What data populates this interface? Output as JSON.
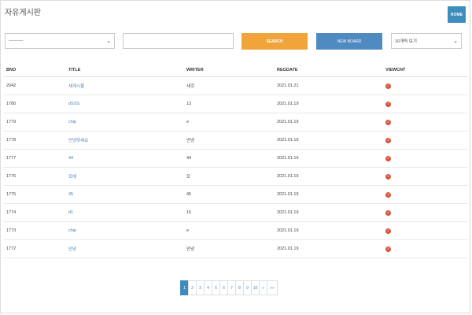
{
  "page": {
    "title": "자유게시판",
    "home_label": "HOME"
  },
  "search": {
    "type_select": "----------",
    "keyword_value": "",
    "search_label": "SEARCH",
    "new_board_label": "NEW BOARD",
    "page_size_select": "10개씩 보기"
  },
  "table": {
    "headers": [
      "BNO",
      "TITLE",
      "WRITER",
      "REGDATE",
      "VIEWCNT"
    ],
    "rows": [
      {
        "bno": "2042",
        "title": "새게시물",
        "writer": "새것",
        "regdate": "2021.01.21",
        "viewcnt": "2"
      },
      {
        "bno": "1780",
        "title": "dSSS",
        "writer": "13",
        "regdate": "2021.01.19",
        "viewcnt": "7"
      },
      {
        "bno": "1779",
        "title": "chip",
        "writer": "e",
        "regdate": "2021.01.19",
        "viewcnt": "2"
      },
      {
        "bno": "1778",
        "title": "안녕하세요",
        "writer": "안녕",
        "regdate": "2021.01.19",
        "viewcnt": "3"
      },
      {
        "bno": "1777",
        "title": "44",
        "writer": "44",
        "regdate": "2021.01.19",
        "viewcnt": "2"
      },
      {
        "bno": "1776",
        "title": "모에",
        "writer": "모",
        "regdate": "2021.01.19",
        "viewcnt": "3"
      },
      {
        "bno": "1775",
        "title": "45",
        "writer": "45",
        "regdate": "2021.01.19",
        "viewcnt": "3"
      },
      {
        "bno": "1774",
        "title": "d1",
        "writer": "15",
        "regdate": "2021.01.19",
        "viewcnt": "4"
      },
      {
        "bno": "1773",
        "title": "chip",
        "writer": "e",
        "regdate": "2021.01.19",
        "viewcnt": "2"
      },
      {
        "bno": "1772",
        "title": "안녕",
        "writer": "안녕",
        "regdate": "2021.01.19",
        "viewcnt": "5"
      }
    ]
  },
  "pagination": {
    "pages": [
      "1",
      "2",
      "3",
      "4",
      "5",
      "6",
      "7",
      "8",
      "9",
      "10"
    ],
    "active": "1",
    "next": "»",
    "last": "»»"
  },
  "colors": {
    "primary": "#3c8dbc",
    "search_button": "#f0a43a",
    "new_board_button": "#4f8ac0",
    "badge": "#d9533b",
    "link": "#4a7fb8"
  }
}
